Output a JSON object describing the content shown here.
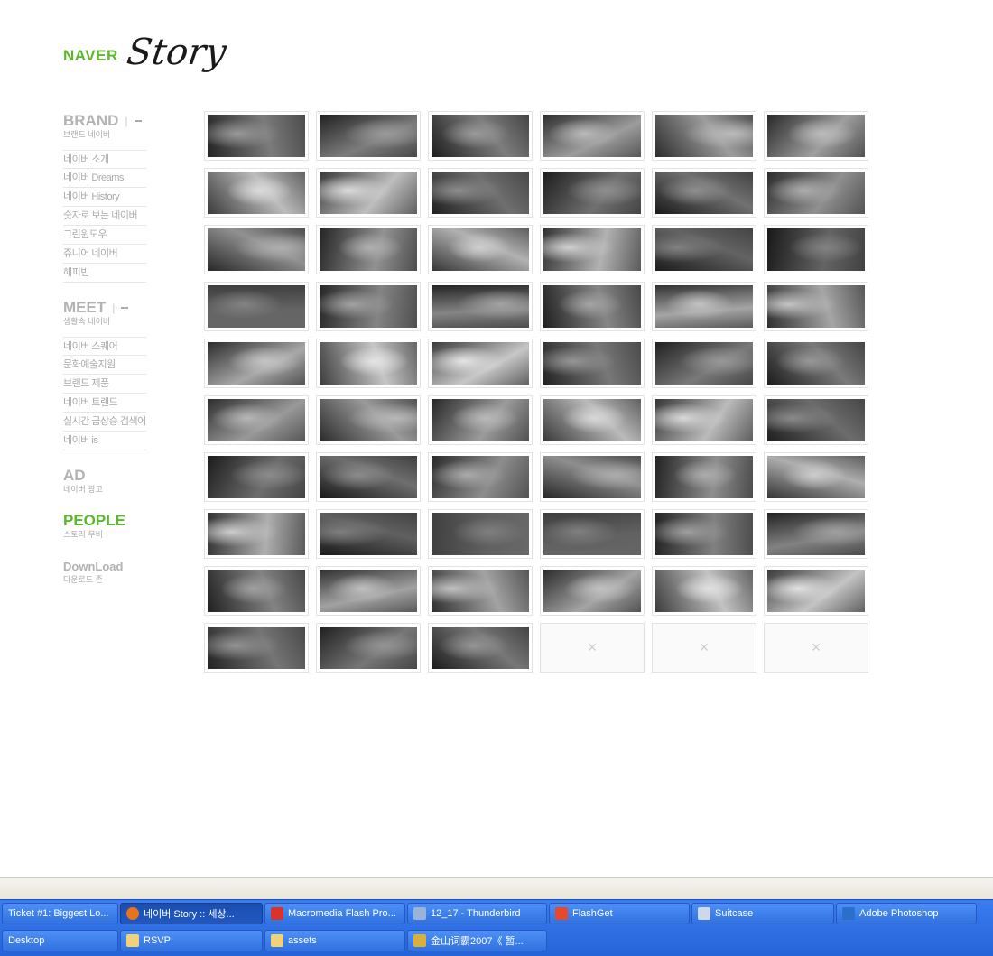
{
  "logo": {
    "brand": "NAVER",
    "script": "Story"
  },
  "sidebar": {
    "sections": [
      {
        "title": "BRAND",
        "subtitle": "브랜드 네이버",
        "pipe": "|",
        "items": [
          "네이버 소개",
          "네이버 Dreams",
          "네이버 History",
          "숫자로 보는 네이버",
          "그린윈도우",
          "쥬니어 네이버",
          "해피빈"
        ]
      },
      {
        "title": "MEET",
        "subtitle": "생활속 네이버",
        "pipe": "|",
        "items": [
          "네이버 스퀘어",
          "문화예술지원",
          "브랜드 제품",
          "네이버 트랜드",
          "실시간 급상승 검색어",
          "네이버 is"
        ]
      },
      {
        "title": "AD",
        "subtitle": "네이버 광고"
      },
      {
        "title": "PEOPLE",
        "subtitle": "스토리 무비",
        "color": "#5cb82b"
      },
      {
        "title": "DownLoad",
        "subtitle": "다운로드 존"
      }
    ]
  },
  "gallery": {
    "rows": 10,
    "columns": 6,
    "thumbnail_count": 57,
    "empty_count": 3,
    "empty_mark": "×"
  },
  "taskbar": {
    "row1": [
      {
        "label": "Ticket #1: Biggest Lo...",
        "icon": "none",
        "active": false
      },
      {
        "label": "네이버 Story :: 세상...",
        "icon": "firefox-icon",
        "active": true,
        "color": "#e8731d"
      },
      {
        "label": "Macromedia Flash Pro...",
        "icon": "flash-icon",
        "active": false,
        "color": "#d9342b"
      },
      {
        "label": "12_17 - Thunderbird",
        "icon": "thunderbird-icon",
        "active": false,
        "color": "#9ab3d6"
      },
      {
        "label": "FlashGet",
        "icon": "flashget-icon",
        "active": false,
        "color": "#e64a2e"
      },
      {
        "label": "Suitcase",
        "icon": "suitcase-icon",
        "active": false,
        "color": "#cfd8e8"
      },
      {
        "label": "Adobe Photoshop",
        "icon": "photoshop-icon",
        "active": false,
        "color": "#2a6fc9"
      }
    ],
    "row2": [
      {
        "label": "Desktop",
        "icon": "none",
        "active": false
      },
      {
        "label": "RSVP",
        "icon": "folder-icon",
        "active": false,
        "color": "#f1d27a"
      },
      {
        "label": "assets",
        "icon": "folder-icon",
        "active": false,
        "color": "#f1d27a"
      },
      {
        "label": "金山词霸2007《 暂...",
        "icon": "dictionary-icon",
        "active": false,
        "color": "#d8b03a"
      }
    ]
  }
}
